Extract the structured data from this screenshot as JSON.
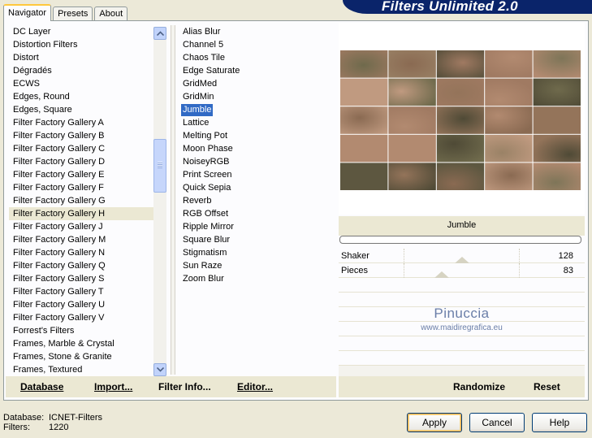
{
  "tabs": [
    {
      "label": "Navigator",
      "active": true
    },
    {
      "label": "Presets",
      "active": false
    },
    {
      "label": "About",
      "active": false
    }
  ],
  "brand": {
    "title": "Filters Unlimited 2.0",
    "color": "#0a246a"
  },
  "categories": {
    "items": [
      "DC Layer",
      "Distortion Filters",
      "Distort",
      "Dégradés",
      "ECWS",
      "Edges, Round",
      "Edges, Square",
      "Filter Factory Gallery A",
      "Filter Factory Gallery B",
      "Filter Factory Gallery C",
      "Filter Factory Gallery D",
      "Filter Factory Gallery E",
      "Filter Factory Gallery F",
      "Filter Factory Gallery G",
      "Filter Factory Gallery H",
      "Filter Factory Gallery J",
      "Filter Factory Gallery M",
      "Filter Factory Gallery N",
      "Filter Factory Gallery Q",
      "Filter Factory Gallery S",
      "Filter Factory Gallery T",
      "Filter Factory Gallery U",
      "Filter Factory Gallery V",
      "Forrest's Filters",
      "Frames, Marble & Crystal",
      "Frames, Stone & Granite",
      "Frames, Textured"
    ],
    "selected": "Filter Factory Gallery H"
  },
  "filters": {
    "items": [
      "Alias Blur",
      "Channel 5",
      "Chaos Tile",
      "Edge Saturate",
      "GridMed",
      "GridMin",
      "Jumble",
      "Lattice",
      "Melting Pot",
      "Moon Phase",
      "NoiseyRGB",
      "Print Screen",
      "Quick Sepia",
      "Reverb",
      "RGB Offset",
      "Ripple Mirror",
      "Square Blur",
      "Stigmatism",
      "Sun Raze",
      "Zoom Blur"
    ],
    "selected": "Jumble"
  },
  "preview": {
    "filter_name": "Jumble",
    "params": [
      {
        "name": "Shaker",
        "value": "128",
        "slider_fraction": 0.5
      },
      {
        "name": "Pieces",
        "value": "83",
        "slider_fraction": 0.33
      }
    ],
    "watermark_title": "Pinuccia",
    "watermark_url": "www.maidiregrafica.eu"
  },
  "toolbar": {
    "database": "Database",
    "import": "Import...",
    "filter_info": "Filter Info...",
    "editor": "Editor...",
    "randomize": "Randomize",
    "reset": "Reset"
  },
  "status": {
    "database_key": "Database:",
    "database_value": "ICNET-Filters",
    "filters_key": "Filters:",
    "filters_value": "1220"
  },
  "buttons": {
    "apply": "Apply",
    "cancel": "Cancel",
    "help": "Help"
  },
  "colors": {
    "selection": "#316ac5",
    "panel_bg": "#ece9d8",
    "highlight": "#ebe8d3"
  }
}
